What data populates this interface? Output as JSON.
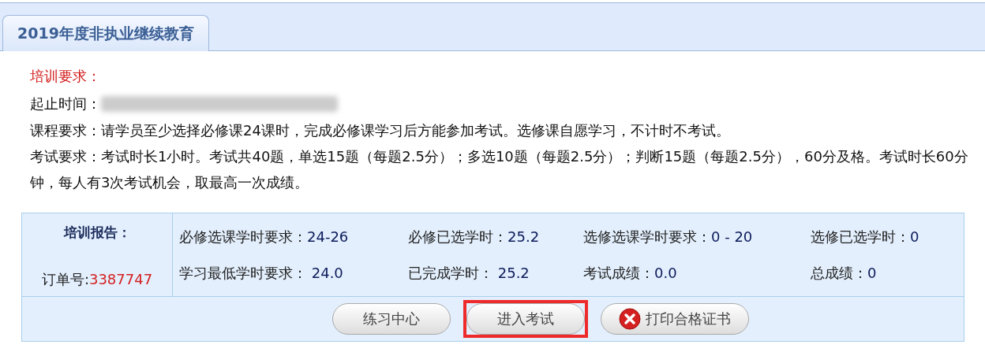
{
  "tabs": [
    {
      "label": "2019年度非执业继续教育",
      "selected": true
    }
  ],
  "requirements": {
    "heading": "培训要求：",
    "period_label": "起止时间：",
    "lines": [
      "课程要求：请学员至少选择必修课24课时，完成必修课学习后方能参加考试。选修课自愿学习，不计时不考试。",
      "考试要求：考试时长1小时。考试共40题，单选15题（每题2.5分）；多选10题（每题2.5分）；判断15题（每题2.5分），60分及格。考试时长60分钟，每人有3次考试机会，取最高一次成绩。"
    ]
  },
  "report": {
    "title": "培训报告：",
    "order_label": "订单号:",
    "order_number": "3387747",
    "rows": [
      [
        {
          "label": "必修选课学时要求：",
          "value": "24-26"
        },
        {
          "label": "必修已选学时：",
          "value": "25.2"
        },
        {
          "label": "选修选课学时要求：",
          "value": "0 - 20"
        },
        {
          "label": "选修已选学时：",
          "value": "0"
        }
      ],
      [
        {
          "label": "学习最低学时要求：",
          "value": " 24.0"
        },
        {
          "label": "已完成学时：",
          "value": " 25.2"
        },
        {
          "label": "考试成绩：",
          "value": "0.0"
        },
        {
          "label": "总成绩：",
          "value": "0"
        }
      ]
    ]
  },
  "buttons": [
    {
      "label": "练习中心",
      "kind": "plain",
      "highlighted": false
    },
    {
      "label": "进入考试",
      "kind": "plain",
      "highlighted": true
    },
    {
      "label": "打印合格证书",
      "kind": "error",
      "highlighted": false
    }
  ]
}
